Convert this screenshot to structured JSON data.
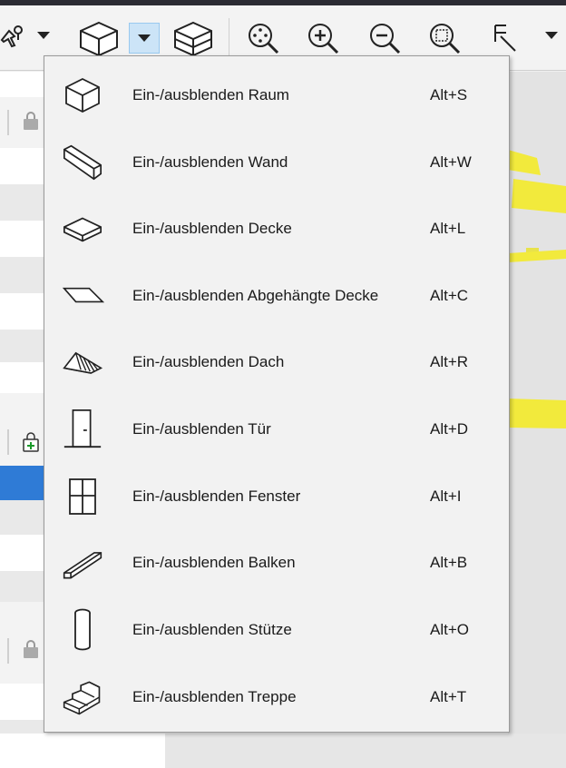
{
  "menu": {
    "items": [
      {
        "label": "Ein-/ausblenden Raum",
        "shortcut": "Alt+S",
        "icon": "room-cube-icon"
      },
      {
        "label": "Ein-/ausblenden Wand",
        "shortcut": "Alt+W",
        "icon": "wall-icon"
      },
      {
        "label": "Ein-/ausblenden Decke",
        "shortcut": "Alt+L",
        "icon": "slab-icon"
      },
      {
        "label": "Ein-/ausblenden Abgehängte Decke",
        "shortcut": "Alt+C",
        "icon": "suspended-ceiling-icon"
      },
      {
        "label": "Ein-/ausblenden Dach",
        "shortcut": "Alt+R",
        "icon": "roof-icon"
      },
      {
        "label": "Ein-/ausblenden Tür",
        "shortcut": "Alt+D",
        "icon": "door-icon"
      },
      {
        "label": "Ein-/ausblenden Fenster",
        "shortcut": "Alt+I",
        "icon": "window-icon"
      },
      {
        "label": "Ein-/ausblenden Balken",
        "shortcut": "Alt+B",
        "icon": "beam-icon"
      },
      {
        "label": "Ein-/ausblenden Stütze",
        "shortcut": "Alt+O",
        "icon": "column-icon"
      },
      {
        "label": "Ein-/ausblenden Treppe",
        "shortcut": "Alt+T",
        "icon": "stair-icon"
      }
    ]
  },
  "toolbar": {
    "icons": [
      "pin-cursor-icon",
      "cube-view-icon",
      "section-box-icon",
      "zoom-extents-icon",
      "zoom-in-icon",
      "zoom-out-icon",
      "zoom-window-icon",
      "select-cursor-icon"
    ]
  },
  "colors": {
    "accent": "#2f7bd6",
    "highlight_yellow": "#f2ea3c",
    "menu_bg": "#f2f2f2"
  }
}
